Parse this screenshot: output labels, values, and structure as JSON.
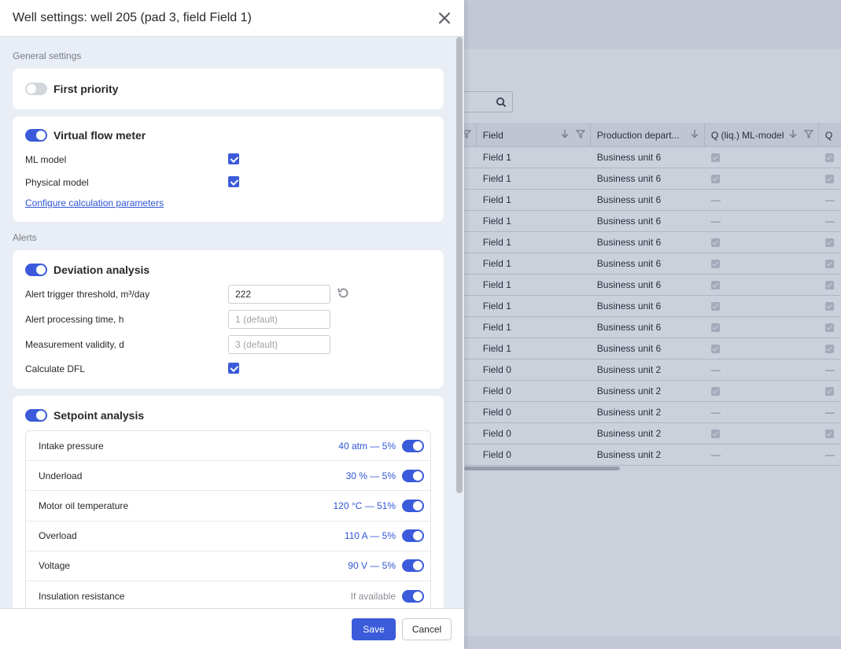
{
  "modal": {
    "title": "Well settings: well 205 (pad 3, field Field 1)",
    "general": {
      "section_label": "General settings",
      "first_priority": {
        "label": "First priority",
        "enabled": false
      },
      "virtual_flow_meter": {
        "label": "Virtual flow meter",
        "enabled": true,
        "ml_model_label": "ML model",
        "ml_model_checked": true,
        "physical_model_label": "Physical model",
        "physical_model_checked": true,
        "configure_link": "Configure calculation parameters"
      }
    },
    "alerts": {
      "section_label": "Alerts",
      "deviation": {
        "label": "Deviation analysis",
        "enabled": true,
        "threshold_label": "Alert trigger threshold, m³/day",
        "threshold_value": "222",
        "processing_label": "Alert processing time, h",
        "processing_placeholder": "1 (default)",
        "validity_label": "Measurement validity, d",
        "validity_placeholder": "3 (default)",
        "dfl_label": "Calculate DFL",
        "dfl_checked": true
      },
      "setpoint": {
        "label": "Setpoint analysis",
        "enabled": true,
        "rows": [
          {
            "name": "Intake pressure",
            "value": "40 atm — 5%",
            "enabled": true
          },
          {
            "name": "Underload",
            "value": "30 % — 5%",
            "enabled": true
          },
          {
            "name": "Motor oil temperature",
            "value": "120 °C — 51%",
            "enabled": true
          },
          {
            "name": "Overload",
            "value": "110 A — 5%",
            "enabled": true
          },
          {
            "name": "Voltage",
            "value": "90 V — 5%",
            "enabled": true
          },
          {
            "name": "Insulation resistance",
            "value": "If available",
            "enabled": true
          }
        ]
      }
    },
    "footer": {
      "save": "Save",
      "cancel": "Cancel"
    }
  },
  "background_table": {
    "headers": [
      "Field",
      "Production depart...",
      "Q (liq.) ML-model",
      "Q"
    ],
    "rows": [
      {
        "field": "Field 1",
        "unit": "Business unit 6",
        "ml": true
      },
      {
        "field": "Field 1",
        "unit": "Business unit 6",
        "ml": true
      },
      {
        "field": "Field 1",
        "unit": "Business unit 6",
        "ml": false
      },
      {
        "field": "Field 1",
        "unit": "Business unit 6",
        "ml": false
      },
      {
        "field": "Field 1",
        "unit": "Business unit 6",
        "ml": true
      },
      {
        "field": "Field 1",
        "unit": "Business unit 6",
        "ml": true
      },
      {
        "field": "Field 1",
        "unit": "Business unit 6",
        "ml": true
      },
      {
        "field": "Field 1",
        "unit": "Business unit 6",
        "ml": true
      },
      {
        "field": "Field 1",
        "unit": "Business unit 6",
        "ml": true
      },
      {
        "field": "Field 1",
        "unit": "Business unit 6",
        "ml": true
      },
      {
        "field": "Field 0",
        "unit": "Business unit 2",
        "ml": false
      },
      {
        "field": "Field 0",
        "unit": "Business unit 2",
        "ml": true
      },
      {
        "field": "Field 0",
        "unit": "Business unit 2",
        "ml": false
      },
      {
        "field": "Field 0",
        "unit": "Business unit 2",
        "ml": true
      },
      {
        "field": "Field 0",
        "unit": "Business unit 2",
        "ml": false
      }
    ],
    "dash": "—"
  }
}
